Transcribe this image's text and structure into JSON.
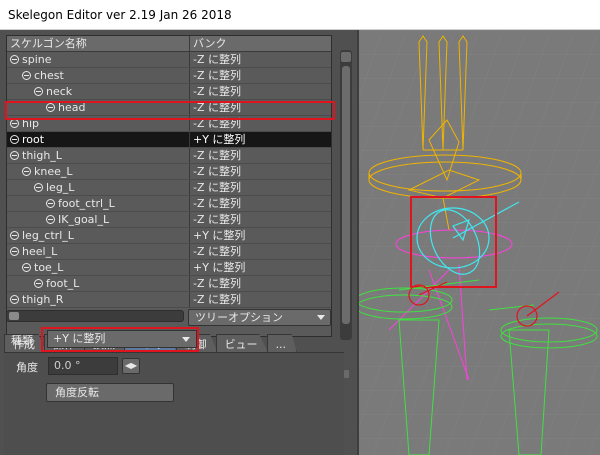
{
  "window": {
    "title": "Skelegon Editor ver 2.19 Jan 26 2018"
  },
  "tree": {
    "headers": {
      "name": "スケルゴン名称",
      "bank": "バンク"
    },
    "rows": [
      {
        "name": "spine",
        "bank": "-Z に整列",
        "depth": 0,
        "selected": false
      },
      {
        "name": "chest",
        "bank": "-Z に整列",
        "depth": 1,
        "selected": false
      },
      {
        "name": "neck",
        "bank": "-Z に整列",
        "depth": 2,
        "selected": false
      },
      {
        "name": "head",
        "bank": "-Z に整列",
        "depth": 3,
        "selected": false
      },
      {
        "name": "hip",
        "bank": "-Z に整列",
        "depth": 0,
        "selected": false
      },
      {
        "name": "root",
        "bank": "+Y に整列",
        "depth": 0,
        "selected": true
      },
      {
        "name": "thigh_L",
        "bank": "-Z に整列",
        "depth": 0,
        "selected": false
      },
      {
        "name": "knee_L",
        "bank": "-Z に整列",
        "depth": 1,
        "selected": false
      },
      {
        "name": "leg_L",
        "bank": "-Z に整列",
        "depth": 2,
        "selected": false
      },
      {
        "name": "foot_ctrl_L",
        "bank": "-Z に整列",
        "depth": 3,
        "selected": false
      },
      {
        "name": "IK_goal_L",
        "bank": "-Z に整列",
        "depth": 3,
        "selected": false
      },
      {
        "name": "leg_ctrl_L",
        "bank": "+Y に整列",
        "depth": 0,
        "selected": false
      },
      {
        "name": "heel_L",
        "bank": "-Z に整列",
        "depth": 0,
        "selected": false
      },
      {
        "name": "toe_L",
        "bank": "+Y に整列",
        "depth": 1,
        "selected": false
      },
      {
        "name": "foot_L",
        "bank": "-Z に整列",
        "depth": 2,
        "selected": false
      },
      {
        "name": "thigh_R",
        "bank": "-Z に整列",
        "depth": 0,
        "selected": false
      }
    ]
  },
  "tree_option": {
    "label": "ツリーオプション"
  },
  "tabs": [
    {
      "label": "作成",
      "active": false
    },
    {
      "label": "操作",
      "active": false
    },
    {
      "label": "頂点",
      "active": false
    },
    {
      "label": "バンク",
      "active": true
    },
    {
      "label": "制御",
      "active": false
    },
    {
      "label": "ビュー",
      "active": false
    },
    {
      "label": "...",
      "active": false
    }
  ],
  "bank_panel": {
    "type_label": "種類",
    "type_value": "+Y に整列",
    "angle_label": "角度",
    "angle_value": "0.0 °",
    "reverse_button": "角度反転"
  },
  "colors": {
    "highlight": "#e0141e",
    "active_tab": "#5e7aa0",
    "selected_row": "#161616",
    "viewport_bg": "#7a7a7a"
  }
}
